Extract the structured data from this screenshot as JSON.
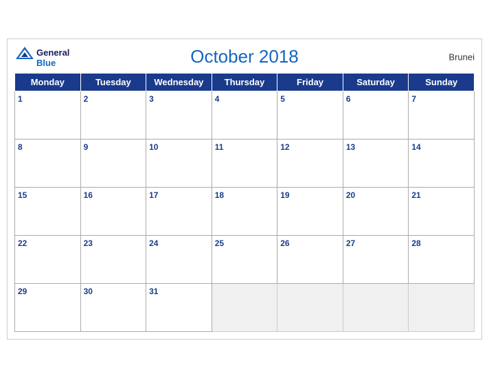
{
  "header": {
    "logo_general": "General",
    "logo_blue": "Blue",
    "title": "October 2018",
    "country": "Brunei"
  },
  "weekdays": [
    "Monday",
    "Tuesday",
    "Wednesday",
    "Thursday",
    "Friday",
    "Saturday",
    "Sunday"
  ],
  "weeks": [
    [
      1,
      2,
      3,
      4,
      5,
      6,
      7
    ],
    [
      8,
      9,
      10,
      11,
      12,
      13,
      14
    ],
    [
      15,
      16,
      17,
      18,
      19,
      20,
      21
    ],
    [
      22,
      23,
      24,
      25,
      26,
      27,
      28
    ],
    [
      29,
      30,
      31,
      null,
      null,
      null,
      null
    ]
  ]
}
